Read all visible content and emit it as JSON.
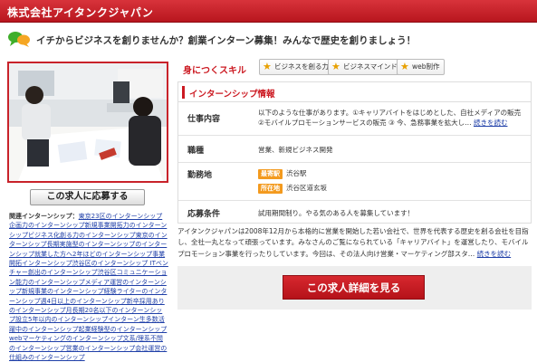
{
  "header": {
    "title": "株式会社アイタンクジャパン"
  },
  "catch": {
    "text": "イチからビジネスを創りませんか？創業インターン募集！みんなで歴史を創りましょう！"
  },
  "apply": {
    "label": "この求人に応募する"
  },
  "related": {
    "label": "関連インターンシップ：",
    "text": "東京23区のインターンシップ企画力のインターンシップ新規事業開拓力のインターンシップビジネス化創る力のインターンシップ東京のインターンシップ長期実施型のインターンシップのインターンシップ就業した方へ2年ほどのインターンシップ事業開拓インターンシップ渋谷区のインターンシップ ITベンチャー創出のインターンシップ渋谷区コミュニケーション能力のインターンシップメディア運営のインターンシップ新規事業のインターンシップ経験ライターのインターンシップ週4日以上のインターンシップ新卒採用ありのインターンシップ月長期20名以下のインターンシップ設立5年以内のインターンシップインターン生多数活躍中のインターンシップ起業経験型のインターンシップwebマーケティングのインターンシップ文系/理系不問のインターンシップ営業のインターンシップ会社運営の仕組みのインターンシップ"
  },
  "skills": {
    "label": "身につくスキル",
    "badges": [
      "ビジネスを創る力",
      "ビジネスマインド",
      "web制作"
    ]
  },
  "info": {
    "title": "インターンシップ情報",
    "job": {
      "key": "仕事内容",
      "value": "以下のような仕事があります。①キャリアバイトをはじめとした、自社メディアの販売 ②モバイルプロモーションサービスの販売 ③ 今、急務事業を拡大し…",
      "more": "続きを読む"
    },
    "type": {
      "key": "職種",
      "value": "営業、新規ビジネス開発"
    },
    "location": {
      "key": "勤務地",
      "station_tag": "最寄駅",
      "station": "渋谷駅",
      "address_tag": "所在地",
      "address": "渋谷区道玄坂"
    },
    "requirements": {
      "key": "応募条件",
      "value": "試用期間制り。やる気のある人を募集しています！"
    }
  },
  "description": {
    "text": "アイタンクジャパンは2008年12月から本格的に営業を開始した若い会社で、世界を代表する歴史を創る会社を目指し、全社一丸となって頑張っています。みなさんのご覧になられている「キャリアバイト」を運営したり、モバイルプロモーション事業を行ったりしています。今回は、その法人向け営業・マーケティング部スタ…",
    "more": "続きを読む"
  },
  "detail": {
    "label": "この求人詳細を見る"
  },
  "colors": {
    "brand_red": "#cc1a22",
    "tag_orange": "#f39a1e",
    "link_blue": "#1f3fa8"
  }
}
